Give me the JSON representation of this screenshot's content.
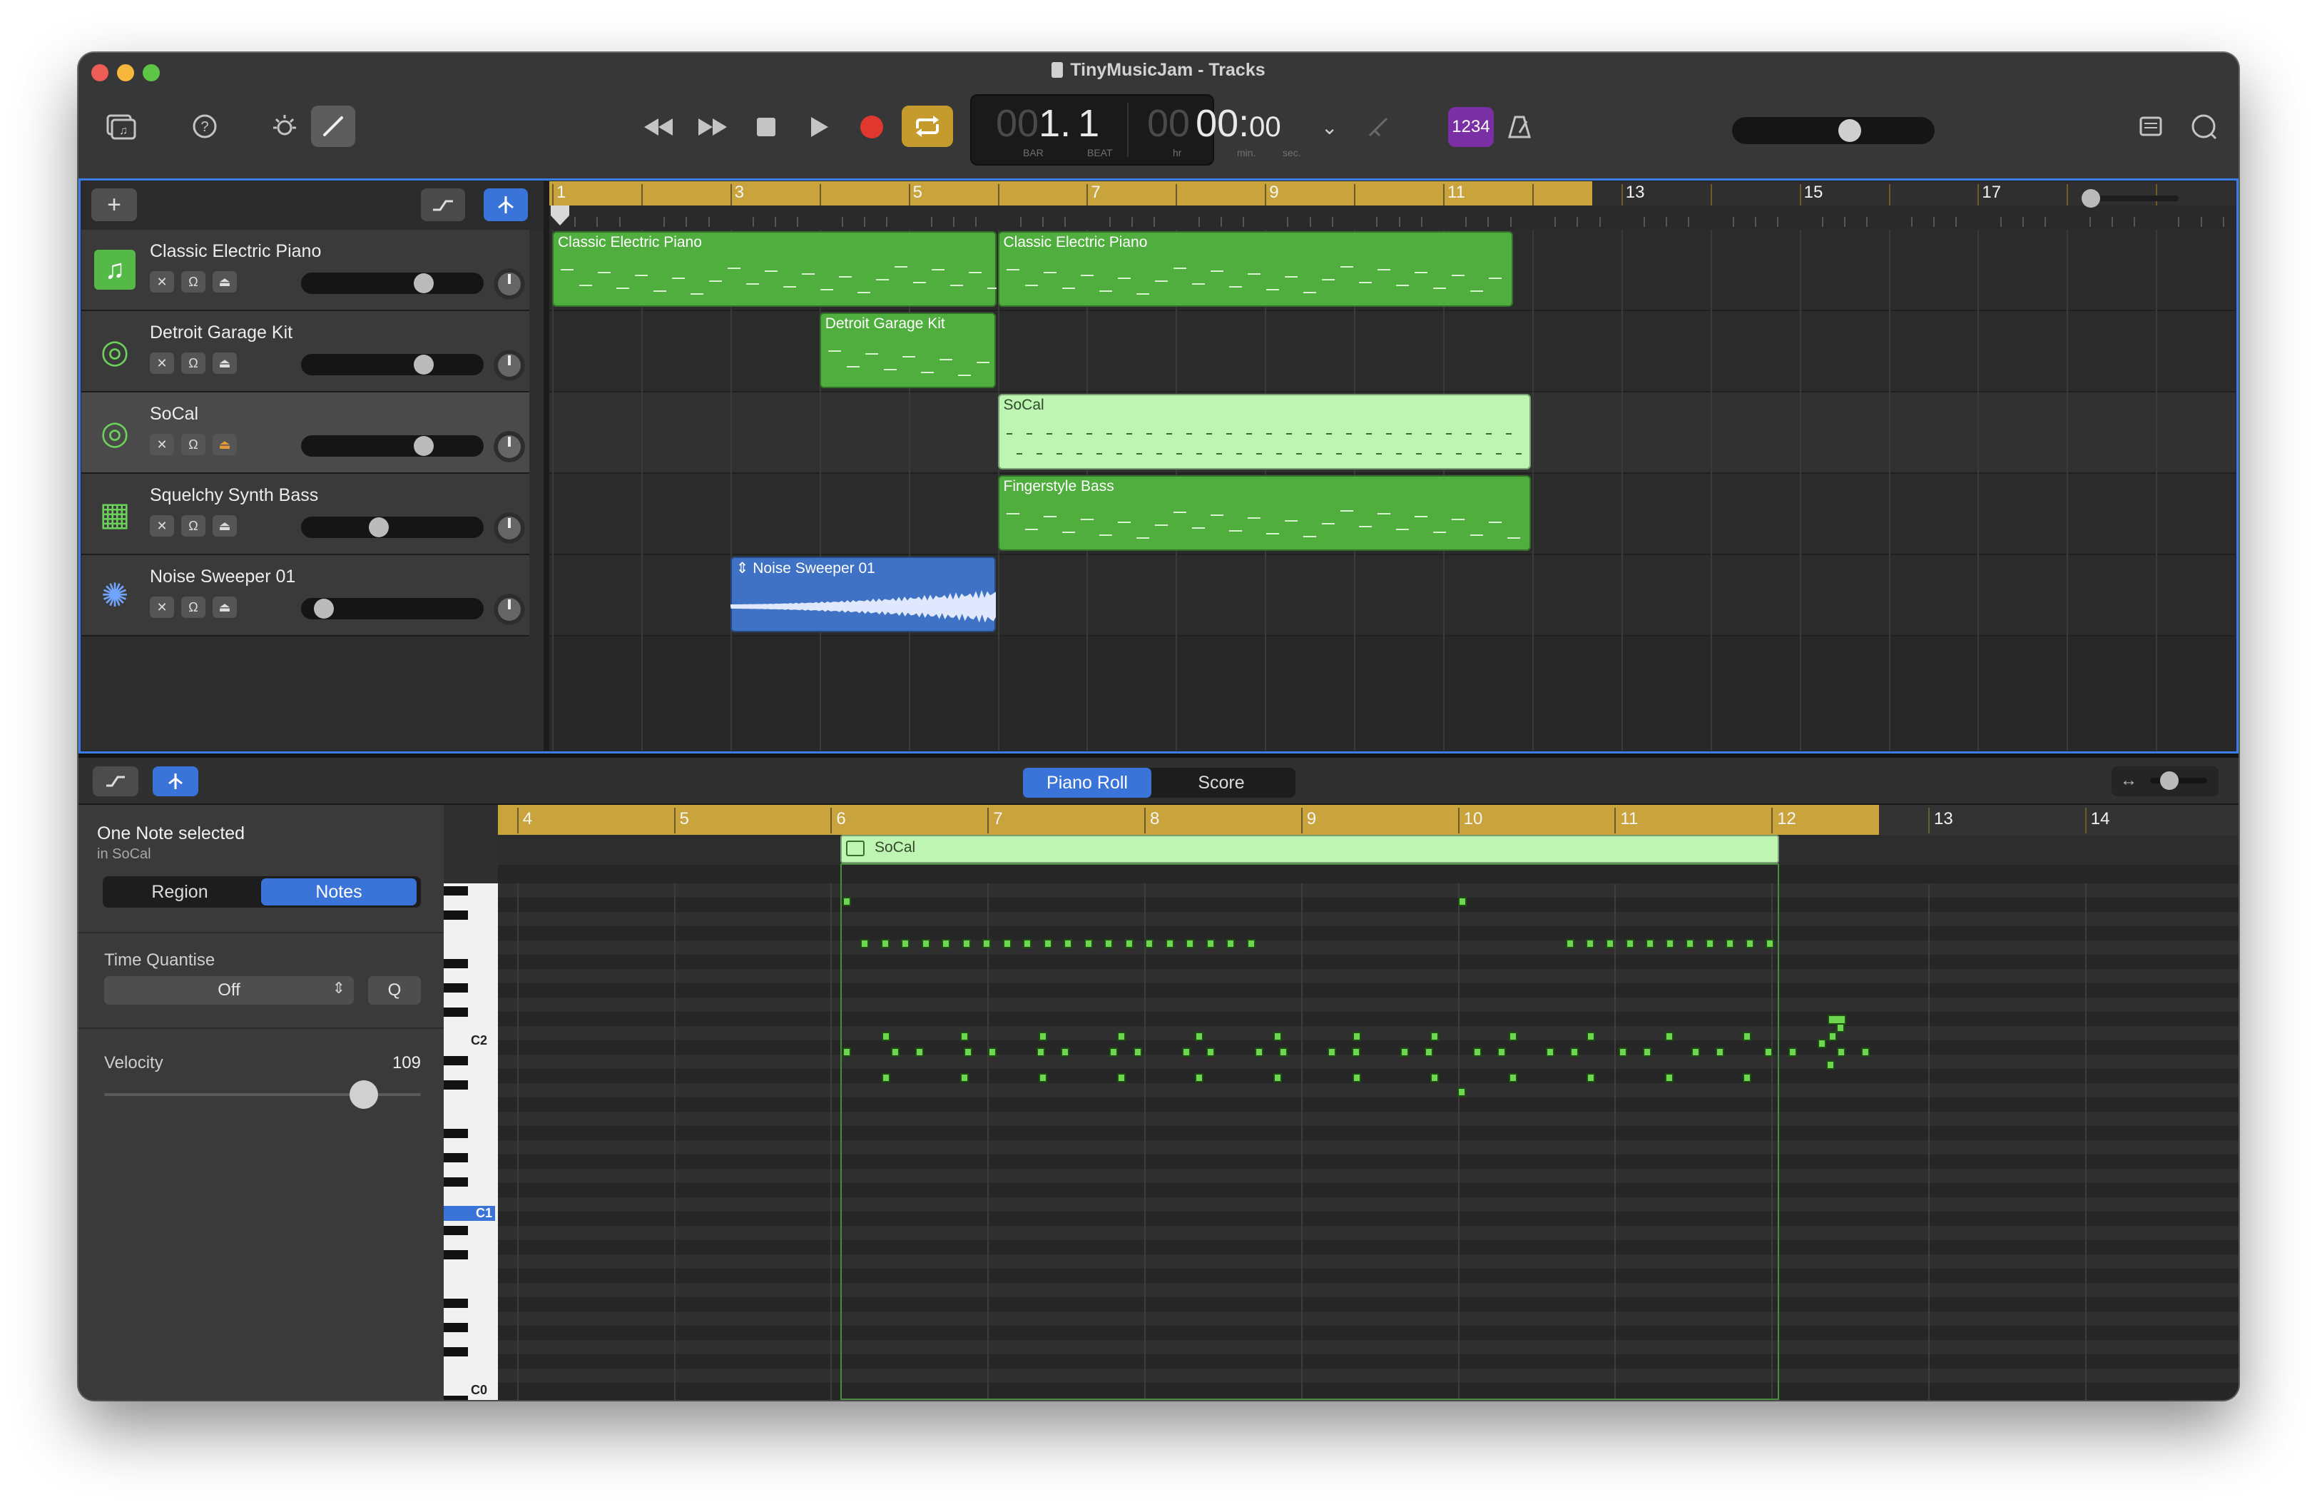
{
  "window": {
    "title": "TinyMusicJam - Tracks"
  },
  "lcd": {
    "bar_dim": "00",
    "bar": "1",
    "sep": ".",
    "beat": "1",
    "bar_label": "BAR",
    "beat_label": "BEAT",
    "hr_dim": "00",
    "time": "00",
    "colon": ":",
    "sec": "00",
    "hr_label": "hr",
    "min_label": "min.",
    "sec_label": "sec."
  },
  "toolbar": {
    "count_in": "1234",
    "icons": [
      "library-icon",
      "help-icon",
      "smart-controls-icon",
      "editors-icon",
      "rewind-icon",
      "forward-icon",
      "stop-icon",
      "play-icon",
      "record-icon",
      "cycle-icon",
      "tuner-icon",
      "metronome-icon",
      "notepad-icon",
      "loops-icon"
    ],
    "master_volume_fraction": 0.6
  },
  "tracks": [
    {
      "name": "Classic Electric Piano",
      "icon": "keyboard-icon",
      "volume": 0.7
    },
    {
      "name": "Detroit Garage Kit",
      "icon": "drum-kit-icon",
      "volume": 0.7
    },
    {
      "name": "SoCal",
      "icon": "drum-kit-icon",
      "volume": 0.7
    },
    {
      "name": "Squelchy Synth Bass",
      "icon": "synth-icon",
      "volume": 0.42
    },
    {
      "name": "Noise Sweeper 01",
      "icon": "sparkle-icon",
      "volume": 0.08
    }
  ],
  "ruler_bars": [
    "1",
    "3",
    "5",
    "7",
    "9",
    "11",
    "13",
    "15",
    "17"
  ],
  "regions": [
    {
      "name": "Classic Electric Piano",
      "track": 0
    },
    {
      "name": "Classic Electric Piano",
      "track": 0
    },
    {
      "name": "Detroit Garage Kit",
      "track": 1
    },
    {
      "name": "SoCal",
      "track": 2
    },
    {
      "name": "Fingerstyle Bass",
      "track": 3
    },
    {
      "name": "Noise Sweeper 01",
      "track": 4
    }
  ],
  "editor": {
    "tabs": [
      "Piano Roll",
      "Score"
    ],
    "active_tab": "Piano Roll",
    "selection_title": "One Note selected",
    "selection_sub": "in SoCal",
    "inspector_tabs": [
      "Region",
      "Notes"
    ],
    "active_inspector_tab": "Notes",
    "time_quantise_label": "Time Quantise",
    "time_quantise_value": "Off",
    "quantise_button": "Q",
    "velocity_label": "Velocity",
    "velocity_value": "109",
    "velocity_fraction": 0.82,
    "region_name": "SoCal",
    "ruler_bars": [
      "4",
      "5",
      "6",
      "7",
      "8",
      "9",
      "10",
      "11",
      "12",
      "13",
      "14"
    ],
    "key_labels": [
      "C2",
      "C1",
      "C0"
    ]
  }
}
